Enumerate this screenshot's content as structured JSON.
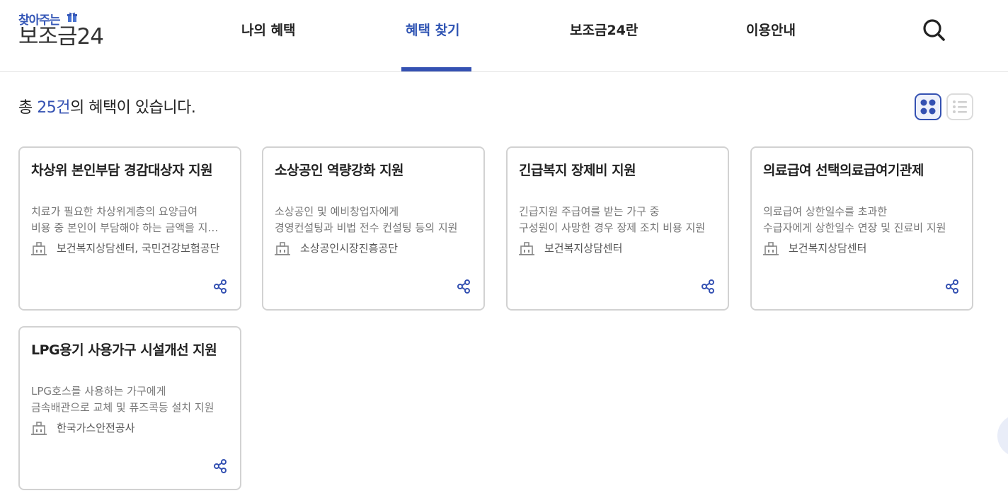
{
  "logo": {
    "top_text": "찾아주는",
    "main_text": "보조금24"
  },
  "nav": {
    "items": [
      {
        "label": "나의 혜택"
      },
      {
        "label": "혜택 찾기"
      },
      {
        "label": "보조금24란"
      },
      {
        "label": "이용안내"
      }
    ]
  },
  "summary": {
    "prefix": "총 ",
    "count": "25건",
    "suffix": "의 혜택이 있습니다."
  },
  "colors": {
    "accent": "#3451b2",
    "card_border": "#d2d2d2",
    "desc_text": "#777777"
  },
  "icons": {
    "search": "search-icon",
    "grid_view": "grid-view-icon",
    "list_view": "list-view-icon",
    "organization": "building-icon",
    "share": "share-icon"
  },
  "cards": [
    {
      "title": "차상위 본인부담 경감대상자 지원",
      "desc_line1": "치료가 필요한 차상위계층의 요양급여",
      "desc_line2": "비용 중 본인이 부담해야 하는 금액을 지원합니다.",
      "org": "보건복지상담센터, 국민건강보험공단"
    },
    {
      "title": "소상공인 역량강화 지원",
      "desc_line1": "소상공인 및 예비창업자에게",
      "desc_line2": "경영컨설팅과 비법 전수 컨설팅 등의 지원",
      "org": "소상공인시장진흥공단"
    },
    {
      "title": "긴급복지 장제비 지원",
      "desc_line1": "긴급지원 주급여를 받는 가구 중",
      "desc_line2": "구성원이 사망한 경우 장제 조치 비용 지원",
      "org": "보건복지상담센터"
    },
    {
      "title": "의료급여 선택의료급여기관제",
      "desc_line1": "의료급여 상한일수를 초과한",
      "desc_line2": "수급자에게 상한일수 연장 및 진료비 지원",
      "org": "보건복지상담센터"
    },
    {
      "title": "LPG용기 사용가구 시설개선 지원",
      "desc_line1": "LPG호스를 사용하는 가구에게",
      "desc_line2": "금속배관으로 교체 및 퓨즈콕등 설치 지원",
      "org": "한국가스안전공사"
    }
  ]
}
